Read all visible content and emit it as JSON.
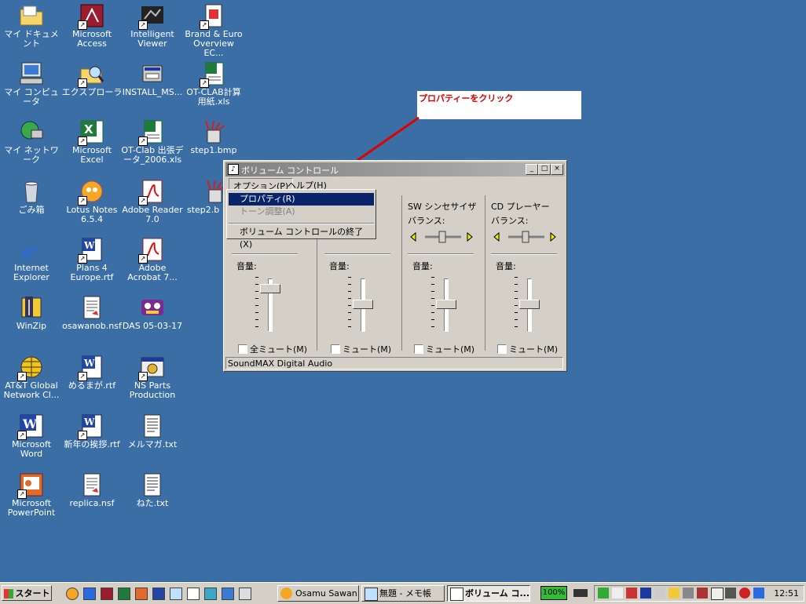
{
  "desktop": {
    "icons": [
      {
        "label": "マイ ドキュメント",
        "icon": "folder-icon",
        "shortcut": false
      },
      {
        "label": "マイ コンピュータ",
        "icon": "computer-icon",
        "shortcut": false
      },
      {
        "label": "マイ ネットワーク",
        "icon": "network-icon",
        "shortcut": false
      },
      {
        "label": "ごみ箱",
        "icon": "recycle-bin-icon",
        "shortcut": false
      },
      {
        "label": "Internet Explorer",
        "icon": "ie-icon",
        "shortcut": false
      },
      {
        "label": "WinZip",
        "icon": "winzip-icon",
        "shortcut": false
      },
      {
        "label": "AT&T Global Network Cl...",
        "icon": "globe-icon",
        "shortcut": true
      },
      {
        "label": "Microsoft Word",
        "icon": "word-icon",
        "shortcut": true
      },
      {
        "label": "Microsoft PowerPoint",
        "icon": "powerpoint-icon",
        "shortcut": true
      },
      {
        "label": "Microsoft Access",
        "icon": "access-icon",
        "shortcut": true
      },
      {
        "label": "エクスプローラ",
        "icon": "explorer-icon",
        "shortcut": true
      },
      {
        "label": "Microsoft Excel",
        "icon": "excel-icon",
        "shortcut": true
      },
      {
        "label": "Lotus Notes 6.5.4",
        "icon": "lotus-notes-icon",
        "shortcut": true
      },
      {
        "label": "Plans 4 Europe.rtf",
        "icon": "word-doc-icon",
        "shortcut": true
      },
      {
        "label": "osawanob.nsf",
        "icon": "nsf-file-icon",
        "shortcut": false
      },
      {
        "label": "めるまが.rtf",
        "icon": "word-doc-icon",
        "shortcut": true
      },
      {
        "label": "新年の挨拶.rtf",
        "icon": "word-doc-icon",
        "shortcut": true
      },
      {
        "label": "replica.nsf",
        "icon": "nsf-file-icon",
        "shortcut": false
      },
      {
        "label": "Intelligent Viewer",
        "icon": "viewer-icon",
        "shortcut": true
      },
      {
        "label": "INSTALL_MS...",
        "icon": "installer-icon",
        "shortcut": false
      },
      {
        "label": "OT-Clab 出張データ_2006.xls",
        "icon": "excel-file-icon",
        "shortcut": true
      },
      {
        "label": "Adobe Reader 7.0",
        "icon": "adobe-reader-icon",
        "shortcut": true
      },
      {
        "label": "Adobe Acrobat 7...",
        "icon": "acrobat-icon",
        "shortcut": true
      },
      {
        "label": "DAS 05-03-17",
        "icon": "das-icon",
        "shortcut": false
      },
      {
        "label": "NS Parts Production",
        "icon": "ns-parts-icon",
        "shortcut": true
      },
      {
        "label": "メルマガ.txt",
        "icon": "text-file-icon",
        "shortcut": false
      },
      {
        "label": "ねた.txt",
        "icon": "text-file-icon",
        "shortcut": false
      },
      {
        "label": "Brand & Euro Overview EC...",
        "icon": "pdf-file-icon",
        "shortcut": true
      },
      {
        "label": "OT-CLAB計算用紙.xls",
        "icon": "excel-file-icon",
        "shortcut": true
      },
      {
        "label": "step1.bmp",
        "icon": "paint-icon",
        "shortcut": false
      },
      {
        "label": "step2.b",
        "icon": "paint-icon",
        "shortcut": false
      }
    ]
  },
  "annotation": {
    "text": "プロパティーをクリック",
    "color": "#e00000"
  },
  "window": {
    "title": "ボリューム コントロール",
    "title_icon": "speaker-icon",
    "menu": [
      "オプション(P)",
      "ヘルプ(H)"
    ],
    "channels": [
      {
        "name": "",
        "balance": "",
        "volume_label": "音量:",
        "mute_label": "全ミュート(M)",
        "level": 0.85
      },
      {
        "name": "",
        "balance": "",
        "volume_label": "音量:",
        "mute_label": "ミュート(M)",
        "level": 0.5
      },
      {
        "name": "SW シンセサイザ",
        "balance": "バランス:",
        "volume_label": "音量:",
        "mute_label": "ミュート(M)",
        "level": 0.5
      },
      {
        "name": "CD プレーヤー",
        "balance": "バランス:",
        "volume_label": "音量:",
        "mute_label": "ミュート(M)",
        "level": 0.5
      }
    ],
    "status": "SoundMAX Digital Audio"
  },
  "dropdown": {
    "items": [
      {
        "label": "プロパティ(R)",
        "state": "highlighted"
      },
      {
        "label": "トーン調整(A)",
        "state": "disabled"
      },
      {
        "label": "ボリューム コントロールの終了(X)",
        "state": "normal"
      }
    ]
  },
  "taskbar": {
    "start_label": "スタート",
    "quick_launch": [
      "lotus-icon",
      "ie-icon",
      "access-icon",
      "excel-icon",
      "powerpoint-icon",
      "word-icon",
      "explorer-icon",
      "notepad-icon",
      "display-icon",
      "network-icon",
      "paint-icon"
    ],
    "tasks": [
      {
        "label": "Osamu Sawan...",
        "icon": "lotus-icon",
        "active": false
      },
      {
        "label": "無題 - メモ帳",
        "icon": "notepad-icon",
        "active": false
      },
      {
        "label": "ボリューム コ...",
        "icon": "speaker-icon",
        "active": true
      }
    ],
    "battery_label": "100%",
    "clock": "12:51"
  }
}
